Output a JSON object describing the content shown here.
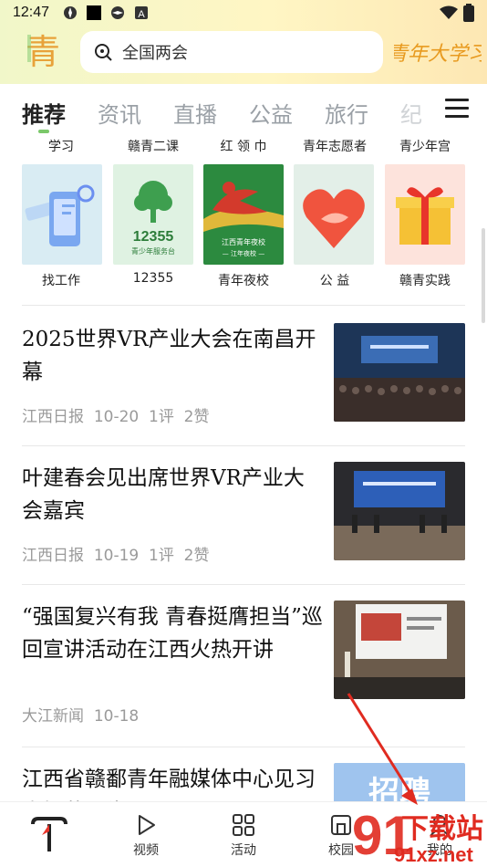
{
  "status_bar": {
    "time": "12:47"
  },
  "header": {
    "logo_char": "青",
    "search_placeholder": "全国两会",
    "right_logo_text": "青年大学习"
  },
  "tabs": [
    "推荐",
    "资讯",
    "直播",
    "公益",
    "旅行",
    "纪"
  ],
  "service_row_top": [
    "学习",
    "赣青二课",
    "红 领 巾",
    "青年志愿者",
    "青少年宫"
  ],
  "service_tiles": [
    {
      "label": "找工作"
    },
    {
      "label": "12355",
      "tile_big": "12355",
      "tile_small": "青少年服务台"
    },
    {
      "label": "青年夜校",
      "tile_big": "江西青年夜校",
      "tile_small": "— 江年夜校 —"
    },
    {
      "label": "公 益"
    },
    {
      "label": "赣青实践"
    }
  ],
  "articles": [
    {
      "title": "2025世界VR产业大会在南昌开幕",
      "source": "江西日报",
      "date": "10-20",
      "comments": "1评",
      "likes": "2赞"
    },
    {
      "title": "叶建春会见出席世界VR产业大会嘉宾",
      "source": "江西日报",
      "date": "10-19",
      "comments": "1评",
      "likes": "2赞"
    },
    {
      "title": "“强国复兴有我 青春挺膺担当”巡回宣讲活动在江西火热开讲",
      "source": "大江新闻",
      "date": "10-18"
    },
    {
      "title": "江西省赣鄱青年融媒体中心见习生招募公告",
      "thumb_text": "招聘"
    }
  ],
  "bottom_nav": [
    "视频",
    "活动",
    "校园",
    "我的"
  ],
  "watermark": {
    "main": "下载站",
    "sub": "91xz.net",
    "big": "91"
  },
  "colors": {
    "accent_green": "#7bc86a",
    "watermark_red": "#e02b20"
  }
}
